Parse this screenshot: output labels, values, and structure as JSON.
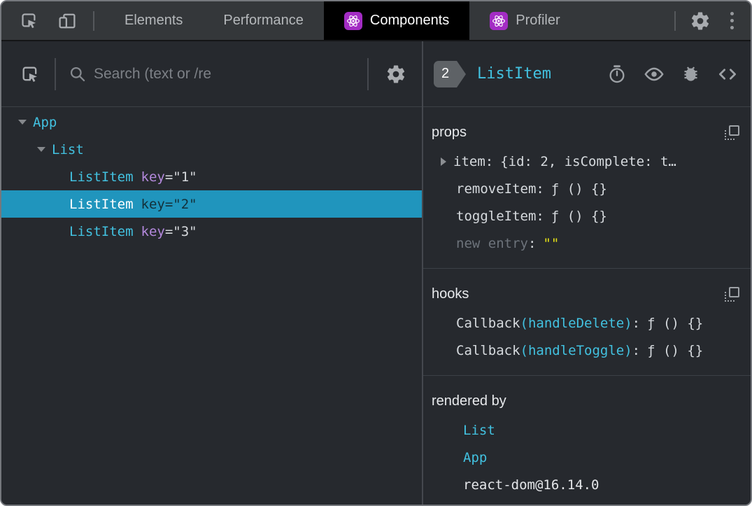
{
  "theme": {
    "accent_cyan": "#42c1e0",
    "accent_purple": "#b489dd",
    "selection_blue": "#2095bd",
    "react_icon_purple": "#a32cc4",
    "string_yellow": "#e5e117",
    "tabbar_bg": "#34373a",
    "panel_bg": "#26292e",
    "active_tab_bg": "#000000"
  },
  "icons": {
    "tabbar": [
      "inspect-cursor-icon",
      "device-toolbar-icon",
      "react-logo-icon",
      "settings-gear-icon",
      "kebab-menu-icon"
    ],
    "left_header": [
      "inspect-cursor-icon",
      "search-icon",
      "settings-gear-icon"
    ],
    "inspector_header": [
      "stopwatch-icon",
      "eye-icon",
      "bug-icon",
      "code-brackets-icon"
    ],
    "sections": [
      "copy-icon"
    ]
  },
  "tabbar": {
    "tabs": [
      {
        "label": "Elements"
      },
      {
        "label": "Performance"
      },
      {
        "label": "Components"
      },
      {
        "label": "Profiler"
      }
    ]
  },
  "search": {
    "placeholder": "Search (text or /re"
  },
  "tree": {
    "rows": [
      {
        "name": "App"
      },
      {
        "name": "List"
      },
      {
        "name": "ListItem",
        "attr_key": "key",
        "attr_val": "=\"1\""
      },
      {
        "name": "ListItem",
        "attr_key": "key",
        "attr_val": "=\"2\""
      },
      {
        "name": "ListItem",
        "attr_key": "key",
        "attr_val": "=\"3\""
      }
    ]
  },
  "inspector": {
    "badge": "2",
    "title": "ListItem",
    "props": {
      "label": "props",
      "rows": [
        {
          "key": "item",
          "value": "{id: 2, isComplete: t…"
        },
        {
          "key": "removeItem",
          "value": "ƒ () {}"
        },
        {
          "key": "toggleItem",
          "value": "ƒ () {}"
        },
        {
          "key": "new entry",
          "value": "\"\""
        }
      ]
    },
    "hooks": {
      "label": "hooks",
      "rows": [
        {
          "fn": "Callback",
          "arg": "(handleDelete)",
          "value": "ƒ () {}"
        },
        {
          "fn": "Callback",
          "arg": "(handleToggle)",
          "value": "ƒ () {}"
        }
      ]
    },
    "rendered_by": {
      "label": "rendered by",
      "items": [
        "List",
        "App",
        "react-dom@16.14.0"
      ]
    }
  },
  "punct": {
    "colon": ":"
  }
}
